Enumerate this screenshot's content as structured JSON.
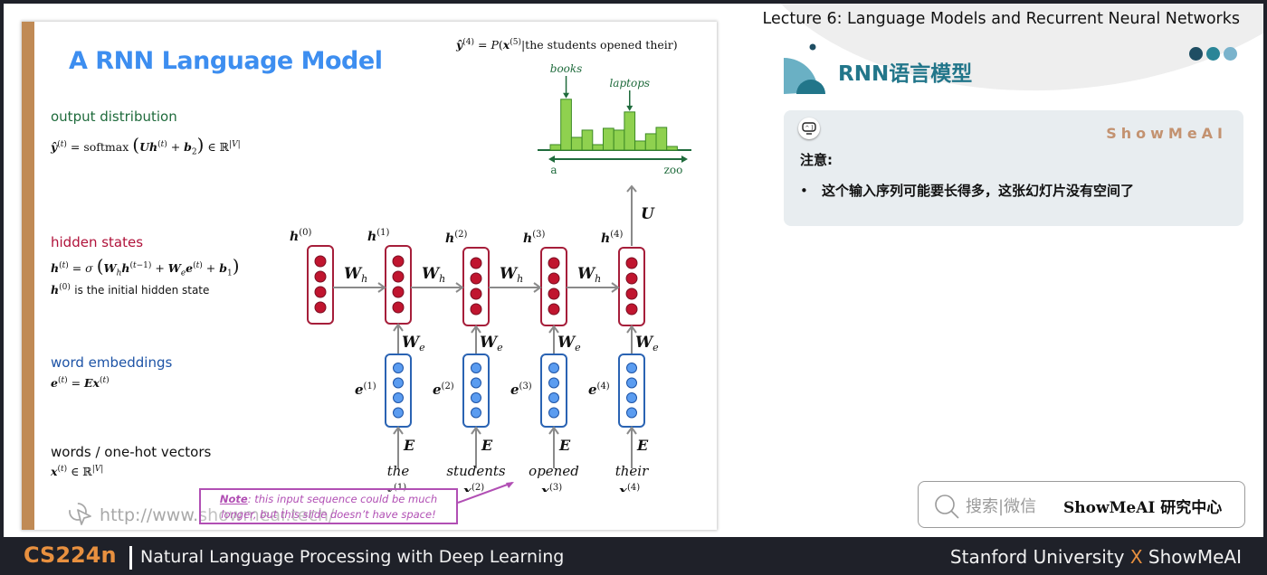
{
  "slide": {
    "title": "A RNN Language Model",
    "top_equation": "ŷ⁽⁴⁾ = P(x⁽⁵⁾|the students opened their)",
    "sections": {
      "output": {
        "label": "output distribution",
        "equation": "ŷ⁽ᵗ⁾ = softmax (Uh⁽ᵗ⁾ + b₂) ∈ ℝ^|V|"
      },
      "hidden": {
        "label": "hidden states",
        "equation": "h⁽ᵗ⁾ = σ (Wₕh⁽ᵗ⁻¹⁾ + Wₑe⁽ᵗ⁾ + b₁)",
        "note_sym": "h⁽⁰⁾",
        "note": "is the initial hidden state"
      },
      "embeddings": {
        "label": "word embeddings",
        "equation": "e⁽ᵗ⁾ = Ex⁽ᵗ⁾"
      },
      "words": {
        "label": "words / one-hot vectors",
        "equation": "x⁽ᵗ⁾ ∈ ℝ^|V|"
      }
    },
    "diagram": {
      "hidden_labels": [
        "h(0)",
        "h(1)",
        "h(2)",
        "h(3)",
        "h(4)"
      ],
      "hidden_sup": [
        "(0)",
        "(1)",
        "(2)",
        "(3)",
        "(4)"
      ],
      "embedding_sup": [
        "(1)",
        "(2)",
        "(3)",
        "(4)"
      ],
      "input_sup": [
        "(1)",
        "(2)",
        "(3)",
        "(4)"
      ],
      "words": [
        "the",
        "students",
        "opened",
        "their"
      ],
      "recurrent_weight": "W",
      "recurrent_sub": "h",
      "embed_weight": "W",
      "embed_sub": "e",
      "embedding_matrix": "E",
      "output_matrix": "U",
      "hidden_color": "#c0152f",
      "embedding_color": "#5b9cf0"
    },
    "note": {
      "bold": "Note",
      "text_line1": ": this input sequence could be much",
      "text_line2": "longer, but this slide doesn’t have space!"
    },
    "watermark": "http://www.showmeai.tech/"
  },
  "chart_data": {
    "type": "bar",
    "title": "",
    "xlabel": "",
    "ylabel": "",
    "x_range_labels": [
      "a",
      "zoo"
    ],
    "categories": [
      "a",
      "",
      "",
      "",
      "",
      "",
      "",
      "",
      "",
      "",
      "",
      "zoo"
    ],
    "values": [
      6,
      56,
      14,
      22,
      6,
      24,
      22,
      42,
      10,
      18,
      25,
      4
    ],
    "ylim": [
      0,
      60
    ],
    "annotations": [
      {
        "label": "books",
        "bar_index": 1
      },
      {
        "label": "laptops",
        "bar_index": 7
      }
    ],
    "bar_color": "#8fd14f",
    "grid": false
  },
  "right_panel": {
    "lecture_title": "Lecture 6:  Language Models and Recurrent Neural Networks",
    "section_title": "RNN语言模型",
    "dot_colors": [
      "#1f4e63",
      "#2a8597",
      "#7ab3cc"
    ],
    "card": {
      "brand": "ShowMeAI",
      "heading": "注意:",
      "bullet": "•",
      "item": "这个输入序列可能要长得多，这张幻灯片没有空间了"
    },
    "search": {
      "placeholder": "搜索|微信",
      "value": "ShowMeAI 研究中心"
    }
  },
  "footer": {
    "course_code": "CS224n",
    "course_name": "Natural Language Processing with Deep Learning",
    "university": "Stanford University",
    "x": "X",
    "partner": "ShowMeAI"
  }
}
